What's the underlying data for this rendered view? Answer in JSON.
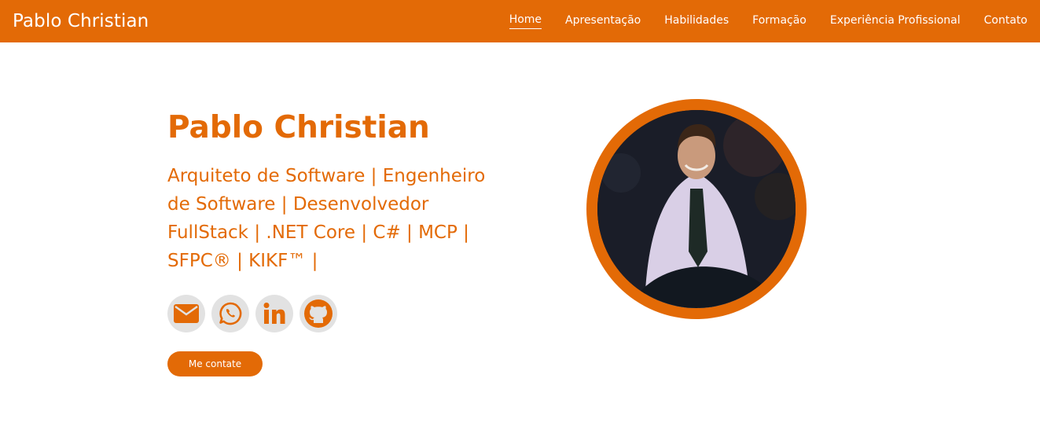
{
  "navbar": {
    "brand": "Pablo Christian",
    "links": [
      "Home",
      "Apresentação",
      "Habilidades",
      "Formação",
      "Experiência Profissional",
      "Contato"
    ],
    "active": "Home"
  },
  "hero": {
    "name": "Pablo Christian",
    "title": "Arquiteto de Software | Engenheiro de Software | Desenvolvedor FullStack | .NET Core | C# | MCP | SFPC® | KIKF™ |",
    "cta_label": "Me contate"
  },
  "social": [
    {
      "icon": "envelope-icon"
    },
    {
      "icon": "whatsapp-icon"
    },
    {
      "icon": "linkedin-icon"
    },
    {
      "icon": "github-icon"
    }
  ],
  "colors": {
    "accent": "#e36a06",
    "icon_bg": "#e2e2e2",
    "white": "#ffffff"
  }
}
